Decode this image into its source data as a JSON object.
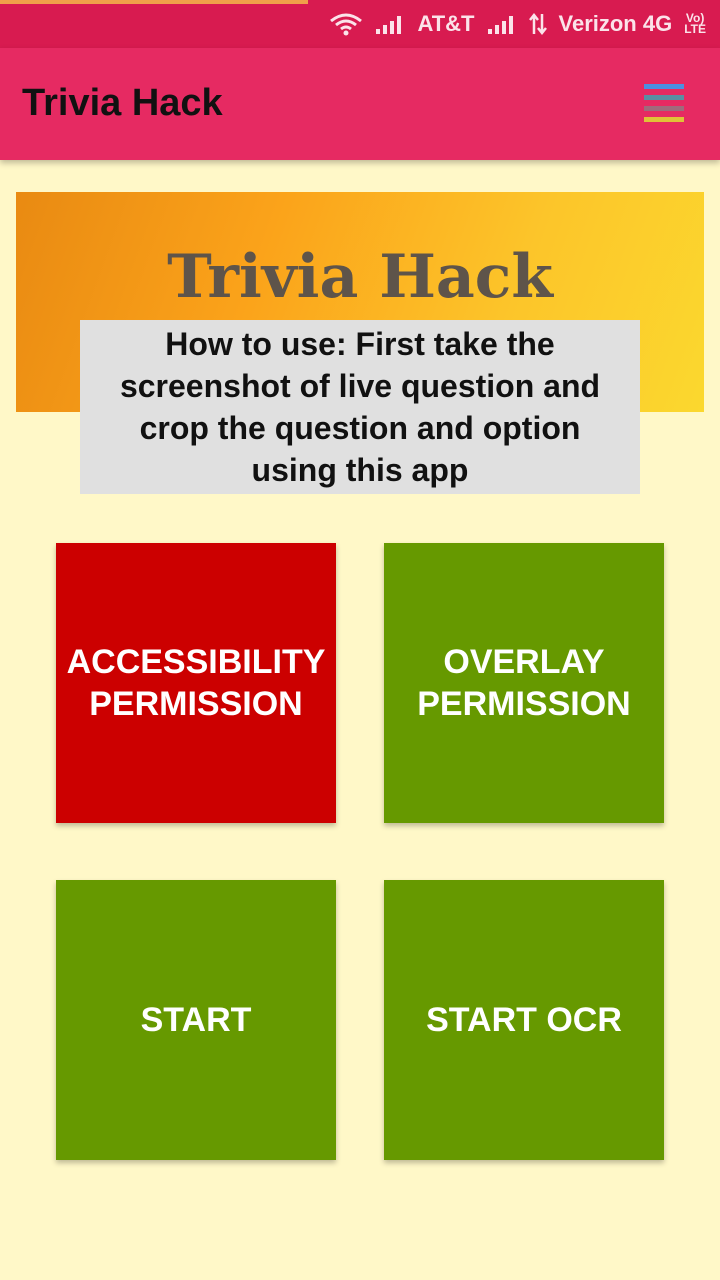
{
  "status_bar": {
    "carrier1": "AT&T",
    "carrier2": "Verizon 4G",
    "volte_top": "Vo)",
    "volte_bottom": "LTE",
    "icons": [
      "wifi-icon",
      "signal-icon",
      "signal-icon",
      "data-arrows-icon",
      "volte-icon"
    ]
  },
  "app_bar": {
    "title": "Trivia Hack",
    "menu_icon": "menu-icon",
    "menu_colors": [
      "#4a90e2",
      "#5a8fa3",
      "#a06a7c",
      "#e0c238"
    ]
  },
  "banner": {
    "heading": "Trivia Hack",
    "instructions": "How to use: First take the screenshot of live question and crop the question and option using this app"
  },
  "buttons": {
    "accessibility": "ACCESSIBILITY PERMISSION",
    "overlay": "OVERLAY PERMISSION",
    "start": "START",
    "start_ocr": "START OCR"
  },
  "colors": {
    "status_bar": "#d81b50",
    "app_bar": "#e62a62",
    "background": "#fff8c8",
    "red_button": "#cc0000",
    "green_button": "#669900"
  }
}
